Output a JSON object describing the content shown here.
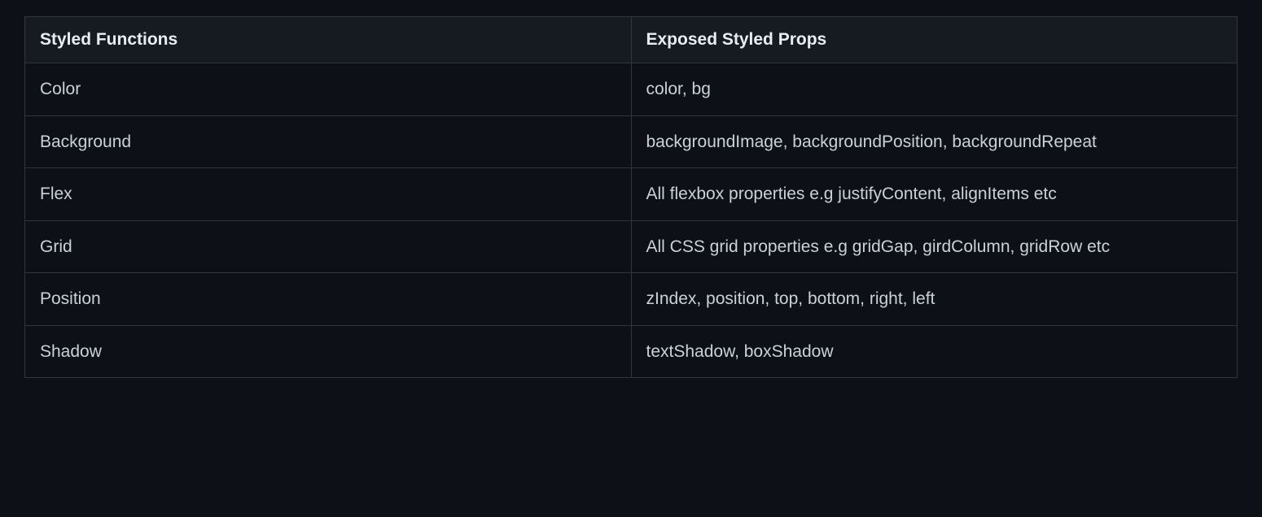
{
  "table": {
    "headers": {
      "col1": "Styled Functions",
      "col2": "Exposed Styled Props"
    },
    "rows": [
      {
        "function": "Color",
        "props": "color, bg"
      },
      {
        "function": "Background",
        "props": "backgroundImage, backgroundPosition, backgroundRepeat"
      },
      {
        "function": "Flex",
        "props": "All flexbox properties e.g justifyContent, alignItems etc"
      },
      {
        "function": "Grid",
        "props": "All CSS grid properties e.g gridGap, girdColumn, gridRow etc"
      },
      {
        "function": "Position",
        "props": "zIndex, position, top, bottom, right, left"
      },
      {
        "function": "Shadow",
        "props": "textShadow, boxShadow"
      }
    ]
  }
}
